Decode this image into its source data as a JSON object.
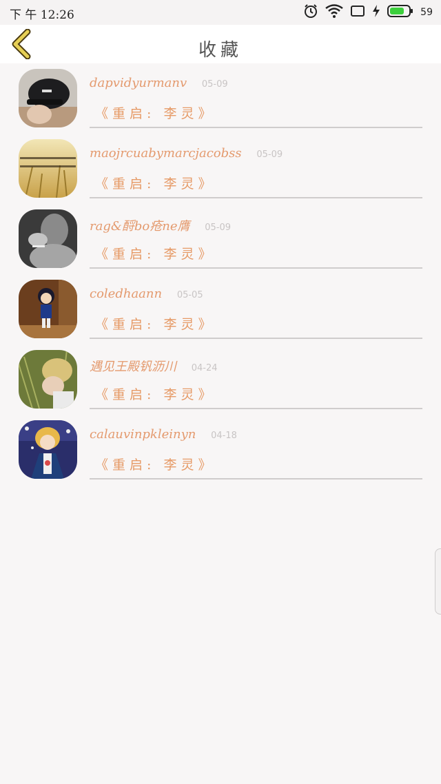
{
  "status_bar": {
    "time": "下 午 12:26",
    "battery_level": "59",
    "icons": [
      "alarm-icon",
      "wifi-icon",
      "screen-icon",
      "charging-icon",
      "battery-icon"
    ],
    "battery_color": "#3ccf3c"
  },
  "header": {
    "title": "收藏",
    "back_icon": "chevron-left-icon",
    "back_color": "#e0c84a"
  },
  "favorites": [
    {
      "name": "dapvidyurmanv",
      "date": "05-09",
      "song": "《重启: 李灵》",
      "avatar": "avatar-cap-person"
    },
    {
      "name": "maojrcuabymarcjacobss",
      "date": "05-09",
      "song": "《重启: 李灵》",
      "avatar": "avatar-field-text"
    },
    {
      "name": "rag&酹bo疮ne膺",
      "date": "05-09",
      "song": "《重启: 李灵》",
      "avatar": "avatar-smoking-man"
    },
    {
      "name": "coledhaann",
      "date": "05-05",
      "song": "《重启: 李灵》",
      "avatar": "avatar-cartoon-boy"
    },
    {
      "name": "遇见王殿钒沥川",
      "date": "04-24",
      "song": "《重启: 李灵》",
      "avatar": "avatar-girl-grass"
    },
    {
      "name": "calauvinpkleinyn",
      "date": "04-18",
      "song": "《重启: 李灵》",
      "avatar": "avatar-anime-prince"
    }
  ],
  "colors": {
    "accent_name": "#e49a6e",
    "date": "#c8c4c4",
    "divider": "#cfcccc"
  }
}
